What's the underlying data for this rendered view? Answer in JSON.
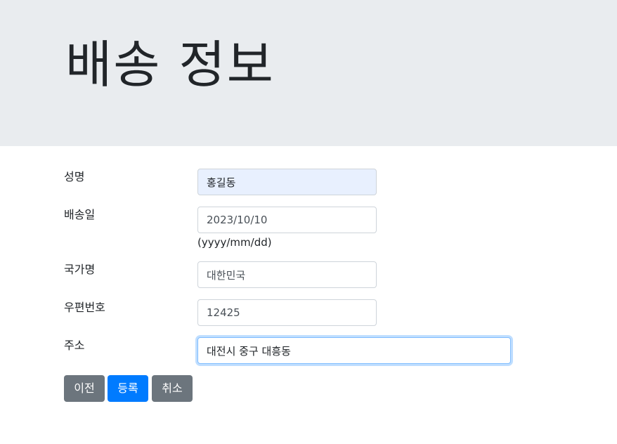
{
  "header": {
    "title": "배송 정보"
  },
  "form": {
    "name": {
      "label": "성명",
      "value": "홍길동"
    },
    "shipping_date": {
      "label": "배송일",
      "value": "2023/10/10",
      "hint": "(yyyy/mm/dd)"
    },
    "country": {
      "label": "국가명",
      "value": "대한민국"
    },
    "zipcode": {
      "label": "우편번호",
      "value": "12425"
    },
    "address": {
      "label": "주소",
      "value": "대전시 중구 대흥동"
    }
  },
  "buttons": {
    "prev": "이전",
    "submit": "등록",
    "cancel": "취소"
  },
  "colors": {
    "header_bg": "#e9ecef",
    "primary": "#007bff",
    "secondary": "#6c757d",
    "autofill_bg": "#e8f0fe",
    "focus_border": "#80bdff"
  }
}
